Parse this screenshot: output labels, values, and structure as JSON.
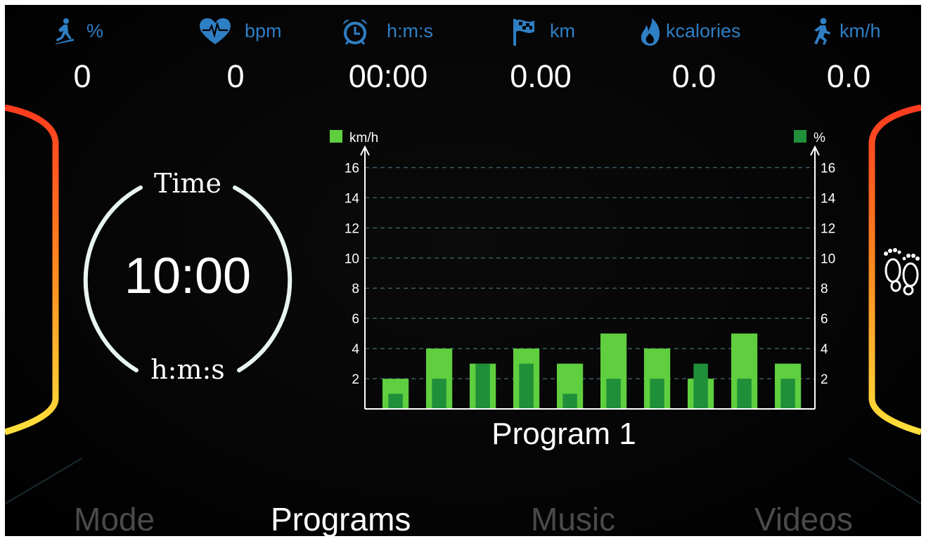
{
  "stats": [
    {
      "icon": "incline-walker-icon",
      "unit": "%",
      "value": "0"
    },
    {
      "icon": "heart-rate-icon",
      "unit": "bpm",
      "value": "0"
    },
    {
      "icon": "alarm-clock-icon",
      "unit": "h:m:s",
      "value": "00:00"
    },
    {
      "icon": "checkered-flag-icon",
      "unit": "km",
      "value": "0.00"
    },
    {
      "icon": "flame-icon",
      "unit": "kcalories",
      "value": "0.0"
    },
    {
      "icon": "runner-icon",
      "unit": "km/h",
      "value": "0.0"
    }
  ],
  "timer": {
    "label_top": "Time",
    "value": "10:00",
    "label_bottom": "h:m:s"
  },
  "colors": {
    "stat_blue": "#2f7fc4",
    "speed_green": "#5fcf3f",
    "incline_green": "#1f8f3a",
    "frame_top": "#ff3b1f",
    "frame_bottom": "#ffe03b"
  },
  "chart_data": {
    "type": "bar",
    "title": "Program 1",
    "legend_left": "km/h",
    "legend_right": "%",
    "y_ticks": [
      2,
      4,
      6,
      8,
      10,
      12,
      14,
      16
    ],
    "ylim": [
      0,
      17
    ],
    "grid": true,
    "series": [
      {
        "name": "km/h",
        "values": [
          2,
          4,
          3,
          4,
          3,
          5,
          4,
          2,
          5,
          3
        ]
      },
      {
        "name": "%",
        "values": [
          1,
          2,
          3,
          3,
          1,
          2,
          2,
          3,
          2,
          2
        ]
      }
    ]
  },
  "nav": [
    "Mode",
    "Programs",
    "Music",
    "Videos"
  ],
  "nav_active": "Programs",
  "side_icon": "footprints-icon"
}
